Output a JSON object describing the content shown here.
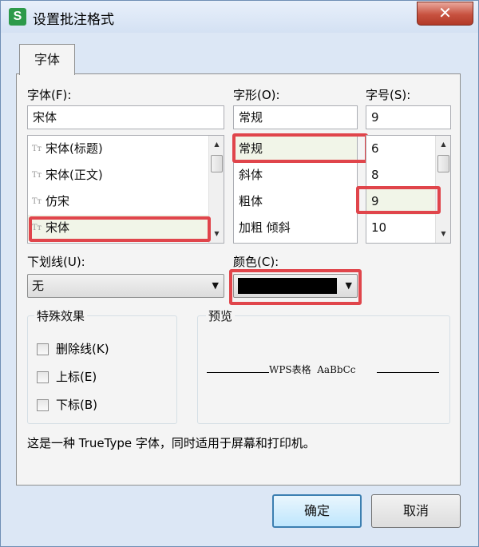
{
  "window": {
    "title": "设置批注格式",
    "app_icon_letter": "S",
    "close_symbol": "✕"
  },
  "tabs": [
    {
      "label": "字体"
    }
  ],
  "font": {
    "label": "字体(F):",
    "value": "宋体",
    "items": [
      "宋体(标题)",
      "宋体(正文)",
      "仿宋",
      "宋体"
    ],
    "type_icon": "Tт",
    "selected_index": 3
  },
  "style": {
    "label": "字形(O):",
    "value": "常规",
    "items": [
      "常规",
      "斜体",
      "粗体",
      "加粗 倾斜"
    ],
    "selected_index": 0
  },
  "size": {
    "label": "字号(S):",
    "value": "9",
    "items": [
      "6",
      "8",
      "9",
      "10"
    ],
    "selected_index": 2
  },
  "underline": {
    "label": "下划线(U):",
    "value": "无"
  },
  "color": {
    "label": "颜色(C):",
    "value": "#000000"
  },
  "effects": {
    "title": "特殊效果",
    "options": [
      {
        "label": "删除线(K)",
        "checked": false
      },
      {
        "label": "上标(E)",
        "checked": false
      },
      {
        "label": "下标(B)",
        "checked": false
      }
    ]
  },
  "preview": {
    "title": "预览",
    "sample": "WPS表格  AaBbCc"
  },
  "info_text": "这是一种 TrueType 字体，同时适用于屏幕和打印机。",
  "buttons": {
    "ok": "确定",
    "cancel": "取消"
  },
  "colors": {
    "highlight_border": "#e0454b",
    "selection_bg": "#f1f5e8",
    "title_bg": "#d4e1f3"
  }
}
